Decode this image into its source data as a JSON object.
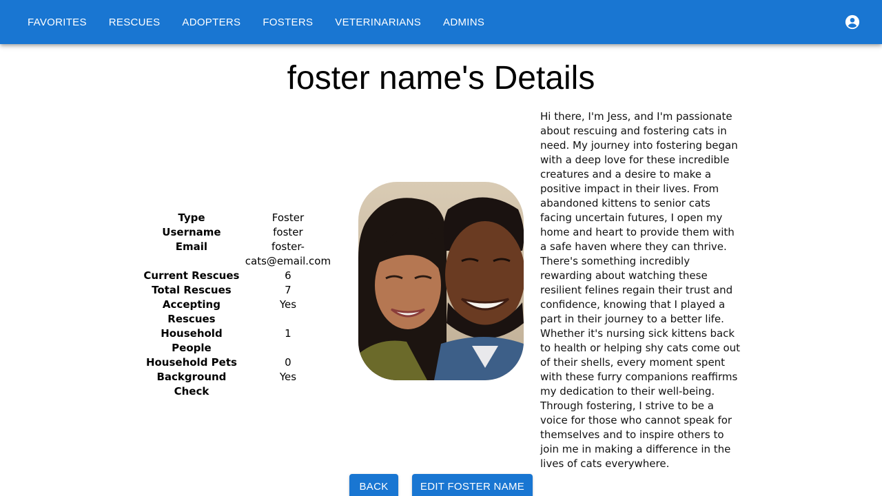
{
  "nav": {
    "items": [
      {
        "label": "FAVORITES"
      },
      {
        "label": "RESCUES"
      },
      {
        "label": "ADOPTERS"
      },
      {
        "label": "FOSTERS"
      },
      {
        "label": "VETERINARIANS"
      },
      {
        "label": "ADMINS"
      }
    ],
    "account_icon": "account-circle-icon"
  },
  "page": {
    "title": "foster name's Details"
  },
  "details": {
    "rows": [
      {
        "label": "Type",
        "value": "Foster"
      },
      {
        "label": "Username",
        "value": "foster"
      },
      {
        "label": "Email",
        "value": "foster-cats@email.com"
      },
      {
        "label": "Current Rescues",
        "value": "6"
      },
      {
        "label": "Total Rescues",
        "value": "7"
      },
      {
        "label": "Accepting Rescues",
        "value": "Yes"
      },
      {
        "label": "Household People",
        "value": "1"
      },
      {
        "label": "Household Pets",
        "value": "0"
      },
      {
        "label": "Background Check",
        "value": "Yes"
      }
    ]
  },
  "bio": {
    "text": "Hi there, I'm Jess, and I'm passionate about rescuing and fostering cats in need. My journey into fostering began with a deep love for these incredible creatures and a desire to make a positive impact in their lives. From abandoned kittens to senior cats facing uncertain futures, I open my home and heart to provide them with a safe haven where they can thrive. There's something incredibly rewarding about watching these resilient felines regain their trust and confidence, knowing that I played a part in their journey to a better life. Whether it's nursing sick kittens back to health or helping shy cats come out of their shells, every moment spent with these furry companions reaffirms my dedication to their well-being. Through fostering, I strive to be a voice for those who cannot speak for themselves and to inspire others to join me in making a difference in the lives of cats everywhere."
  },
  "actions": {
    "back_label": "BACK",
    "edit_label": "EDIT FOSTER NAME"
  },
  "colors": {
    "primary": "#1976d2"
  }
}
